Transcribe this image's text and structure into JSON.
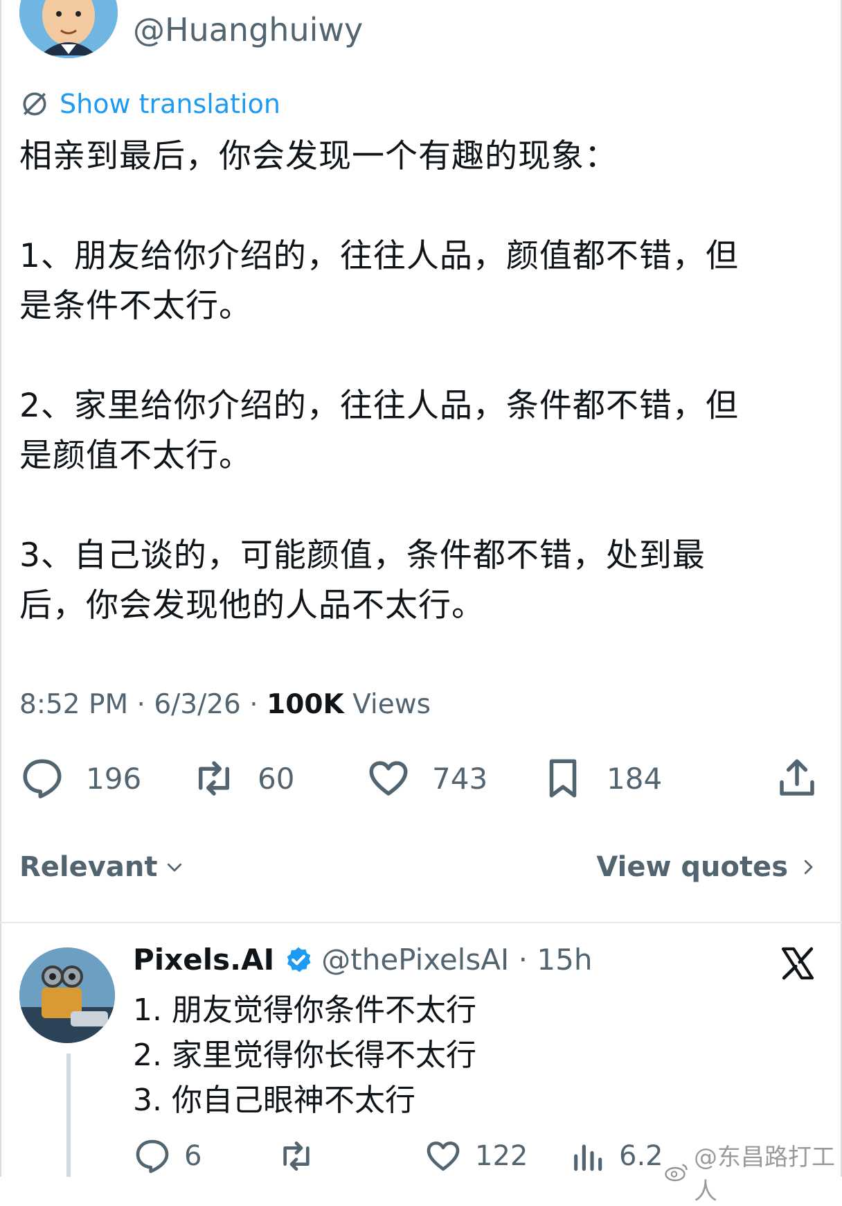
{
  "author": {
    "handle": "@Huanghuiwy"
  },
  "translation": {
    "label": "Show translation"
  },
  "tweet": {
    "intro": "相亲到最后，你会发现一个有趣的现象：",
    "point1_line1": "1、朋友给你介绍的，往往人品，颜值都不错，但",
    "point1_line2": "是条件不太行。",
    "point2_line1": "2、家里给你介绍的，往往人品，条件都不错，但",
    "point2_line2": "是颜值不太行。",
    "point3_line1": "3、自己谈的，可能颜值，条件都不错，处到最",
    "point3_line2": "后，你会发现他的人品不太行。"
  },
  "meta": {
    "time": "8:52 PM · 6/3/26 · ",
    "views_count": "100K",
    "views_label": " Views"
  },
  "actions": {
    "replies": "196",
    "reposts": "60",
    "likes": "743",
    "bookmarks": "184"
  },
  "sort": {
    "label": "Relevant"
  },
  "quotes": {
    "label": "View quotes"
  },
  "reply": {
    "name": "Pixels.AI",
    "handle_time": "@thePixelsAI · 15h",
    "line1": "1. 朋友觉得你条件不太行",
    "line2": "2. 家里觉得你长得不太行",
    "line3": "3. 你自己眼神不太行",
    "replies": "6",
    "likes": "122",
    "views": "6.2"
  },
  "watermark": "@东昌路打工人",
  "colors": {
    "accent": "#1d9bf0",
    "muted": "#536471",
    "text": "#0f1419"
  }
}
